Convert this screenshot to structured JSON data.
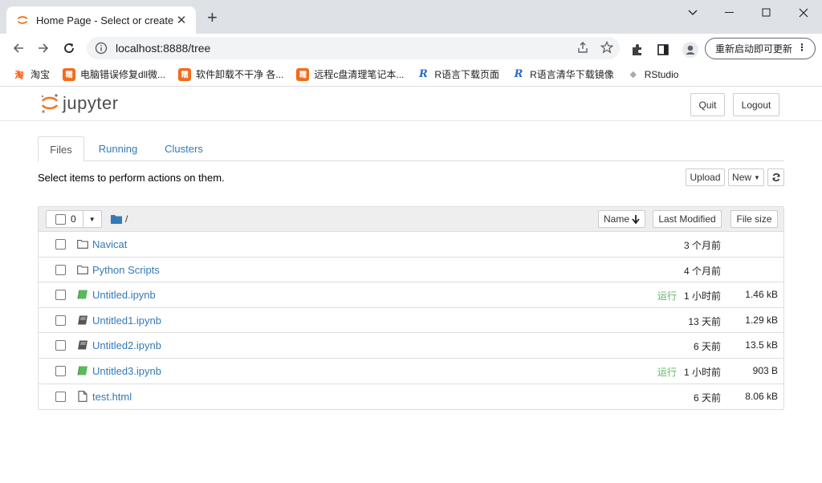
{
  "browser": {
    "tab_title": "Home Page - Select or create",
    "url": "localhost:8888/tree",
    "update_button": "重新启动即可更新",
    "bookmarks": [
      {
        "icon": "taobao",
        "label": "淘宝"
      },
      {
        "icon": "nuo",
        "label": "电脑错误修复dll微..."
      },
      {
        "icon": "nuo",
        "label": "软件卸载不干净 各..."
      },
      {
        "icon": "nuo",
        "label": "远程c盘清理笔记本..."
      },
      {
        "icon": "r",
        "label": "R语言下载页面"
      },
      {
        "icon": "r",
        "label": "R语言清华下载镜像"
      },
      {
        "icon": "rs",
        "label": "RStudio"
      }
    ]
  },
  "jupyter": {
    "logo_text": "jupyter",
    "quit_label": "Quit",
    "logout_label": "Logout",
    "tabs": [
      "Files",
      "Running",
      "Clusters"
    ],
    "instructions": "Select items to perform actions on them.",
    "upload_label": "Upload",
    "new_label": "New",
    "selected_count": "0",
    "path": "/",
    "columns": {
      "name": "Name",
      "last_modified": "Last Modified",
      "file_size": "File size"
    },
    "files": [
      {
        "type": "folder",
        "name": "Navicat",
        "running": "",
        "modified": "3 个月前",
        "size": ""
      },
      {
        "type": "folder",
        "name": "Python Scripts",
        "running": "",
        "modified": "4 个月前",
        "size": ""
      },
      {
        "type": "notebook-running",
        "name": "Untitled.ipynb",
        "running": "运行",
        "modified": "1 小时前",
        "size": "1.46 kB"
      },
      {
        "type": "notebook",
        "name": "Untitled1.ipynb",
        "running": "",
        "modified": "13 天前",
        "size": "1.29 kB"
      },
      {
        "type": "notebook",
        "name": "Untitled2.ipynb",
        "running": "",
        "modified": "6 天前",
        "size": "13.5 kB"
      },
      {
        "type": "notebook-running",
        "name": "Untitled3.ipynb",
        "running": "运行",
        "modified": "1 小时前",
        "size": "903 B"
      },
      {
        "type": "file",
        "name": "test.html",
        "running": "",
        "modified": "6 天前",
        "size": "8.06 kB"
      }
    ]
  },
  "colors": {
    "link": "#337ab7",
    "running": "#5cb85c",
    "jupyter_orange": "#f37726"
  }
}
